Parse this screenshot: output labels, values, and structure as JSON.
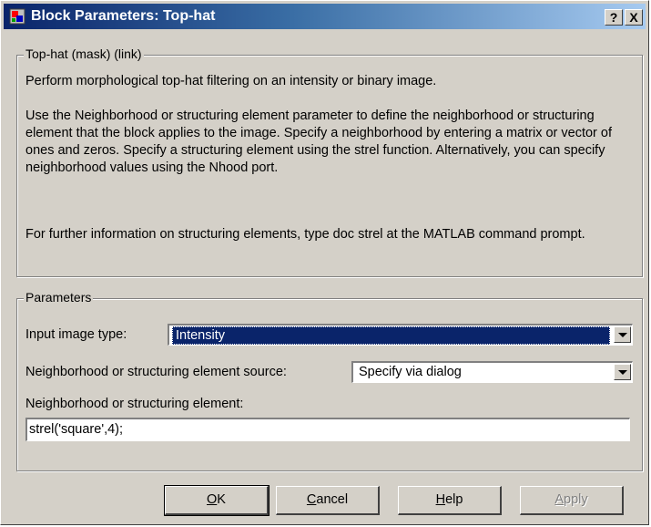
{
  "window": {
    "title": "Block Parameters: Top-hat"
  },
  "titlebar_buttons": {
    "help": "?",
    "close": "X"
  },
  "mask_group": {
    "legend": "Top-hat (mask) (link)",
    "paragraph1": "Perform morphological top-hat filtering on an intensity or binary image.",
    "paragraph2": "Use the Neighborhood or structuring element parameter to define the neighborhood or structuring element that the block applies to the image.  Specify a neighborhood by entering a matrix or vector of ones and zeros.  Specify a structuring element using the strel function.  Alternatively, you can specify neighborhood values using the Nhood port.",
    "paragraph3": "For further information on structuring elements, type doc strel at the MATLAB command prompt."
  },
  "parameters": {
    "legend": "Parameters",
    "input_image_type": {
      "label": "Input image type:",
      "value": "Intensity"
    },
    "nhood_source": {
      "label": "Neighborhood or structuring element source:",
      "value": "Specify via dialog"
    },
    "nhood": {
      "label": "Neighborhood or structuring element:",
      "value": "strel('square',4);"
    }
  },
  "buttons": {
    "ok": {
      "first": "O",
      "rest": "K"
    },
    "cancel": {
      "first": "C",
      "rest": "ancel"
    },
    "help": {
      "first": "H",
      "rest": "elp"
    },
    "apply": {
      "first": "A",
      "rest": "pply"
    }
  }
}
